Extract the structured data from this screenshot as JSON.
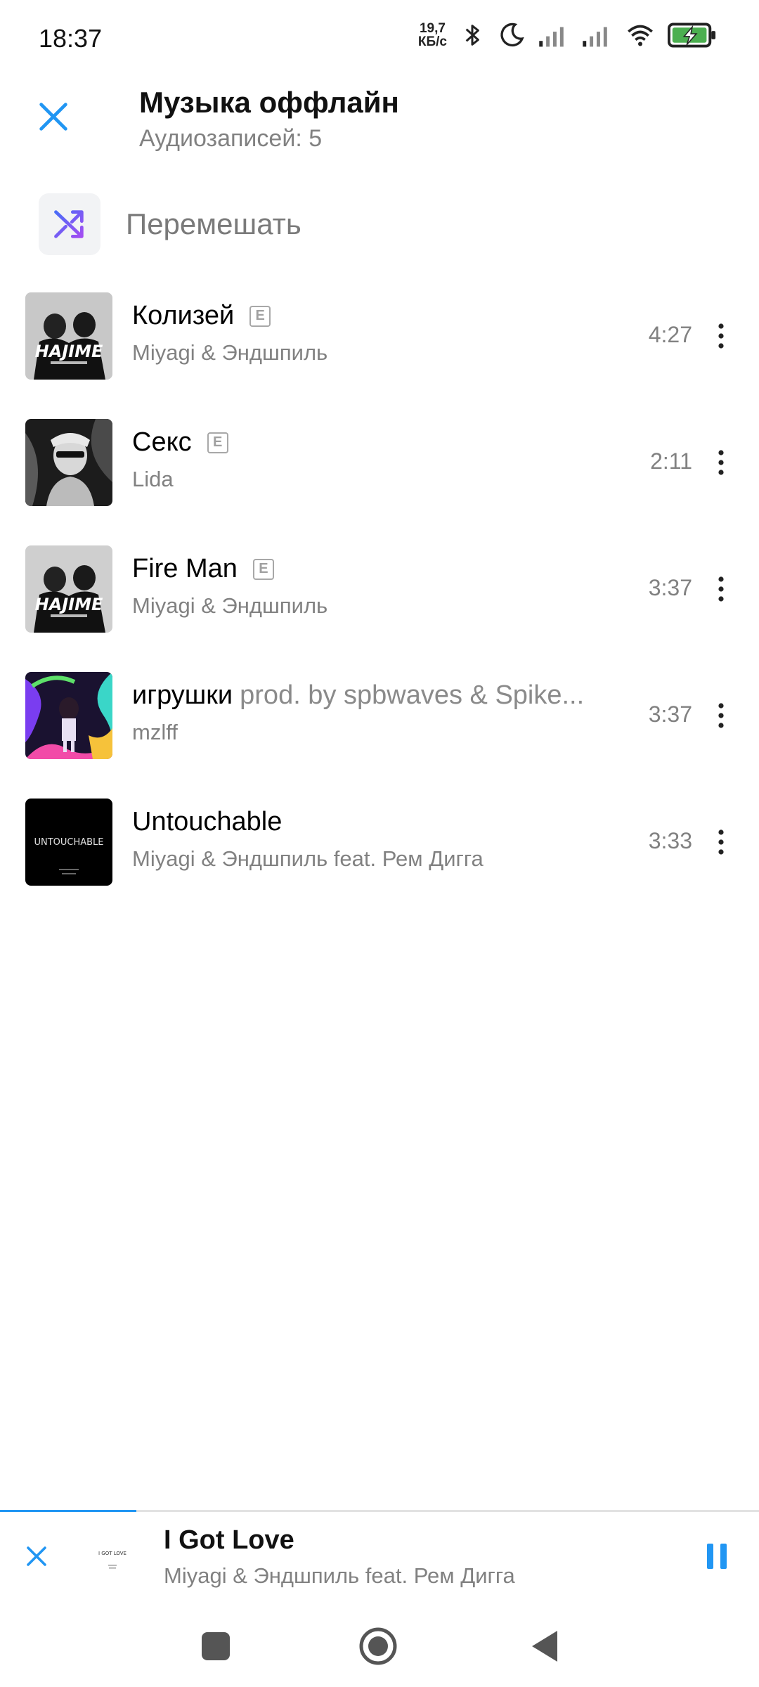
{
  "status_bar": {
    "time": "18:37",
    "speed_value": "19,7",
    "speed_unit": "КБ/с",
    "icons": [
      "bluetooth-icon",
      "moon-icon",
      "signal-icon",
      "signal-icon",
      "wifi-icon",
      "battery-charging-icon"
    ]
  },
  "header": {
    "title": "Музыка оффлайн",
    "subtitle": "Аудиозаписей: 5",
    "close_icon": "close-icon"
  },
  "shuffle": {
    "label": "Перемешать",
    "icon": "shuffle-icon"
  },
  "tracks": [
    {
      "title": "Колизей",
      "suffix": "",
      "explicit": true,
      "artist": "Miyagi & Эндшпиль",
      "duration": "4:27",
      "cover": "hajime-cover"
    },
    {
      "title": "Секс",
      "suffix": "",
      "explicit": true,
      "artist": "Lida",
      "duration": "2:11",
      "cover": "lida-cover"
    },
    {
      "title": "Fire Man",
      "suffix": "",
      "explicit": true,
      "artist": "Miyagi & Эндшпиль",
      "duration": "3:37",
      "cover": "hajime-cover"
    },
    {
      "title": "игрушки",
      "suffix": "prod. by spbwaves & Spike...",
      "explicit": false,
      "artist": "mzlff",
      "duration": "3:37",
      "cover": "igrushki-cover"
    },
    {
      "title": "Untouchable",
      "suffix": "",
      "explicit": false,
      "artist": "Miyagi & Эндшпиль feat. Рем Дигга",
      "duration": "3:33",
      "cover": "untouchable-cover"
    }
  ],
  "explicit_badge": "E",
  "hajime_cover_text": "HAJIME",
  "untouchable_cover_text": "UNTOUCHABLE",
  "mini_player": {
    "title": "I Got Love",
    "artist": "Miyagi & Эндшпиль feat. Рем Дигга",
    "progress": 0.18,
    "cover_text": "I GOT LOVE"
  },
  "nav_bar": {
    "icons": [
      "recents-icon",
      "home-icon",
      "back-icon"
    ]
  },
  "colors": {
    "accent": "#2196f3",
    "shuffle_gradient": [
      "#4a6cf7",
      "#a34df2"
    ],
    "text_secondary": "#818181"
  }
}
